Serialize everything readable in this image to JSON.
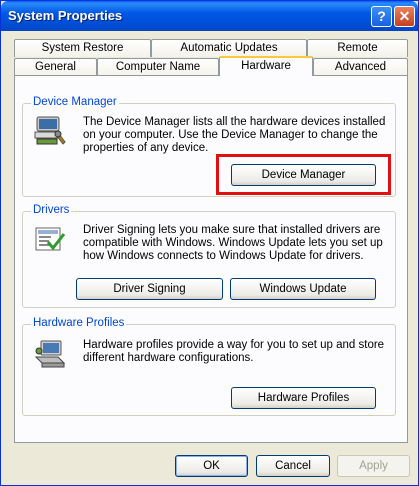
{
  "window": {
    "title": "System Properties"
  },
  "titlebar": {
    "help_label": "?",
    "close_label": "✕"
  },
  "tabs": {
    "top_row": [
      "System Restore",
      "Automatic Updates",
      "Remote"
    ],
    "bottom_row": [
      "General",
      "Computer Name",
      "Hardware",
      "Advanced"
    ],
    "active": "Hardware"
  },
  "device_manager": {
    "title": "Device Manager",
    "description": "The Device Manager lists all the hardware devices installed on your computer. Use the Device Manager to change the properties of any device.",
    "button": "Device Manager",
    "icon": "device-manager-icon"
  },
  "drivers": {
    "title": "Drivers",
    "description": "Driver Signing lets you make sure that installed drivers are compatible with Windows. Windows Update lets you set up how Windows connects to Windows Update for drivers.",
    "driver_signing_button": "Driver Signing",
    "windows_update_button": "Windows Update",
    "icon": "drivers-icon"
  },
  "hardware_profiles": {
    "title": "Hardware Profiles",
    "description": "Hardware profiles provide a way for you to set up and store different hardware configurations.",
    "button": "Hardware Profiles",
    "icon": "hardware-profiles-icon"
  },
  "footer": {
    "ok": "OK",
    "cancel": "Cancel",
    "apply": "Apply"
  },
  "colors": {
    "highlight": "#e01010",
    "group_title": "#0046d5",
    "titlebar": "#0058e6"
  }
}
